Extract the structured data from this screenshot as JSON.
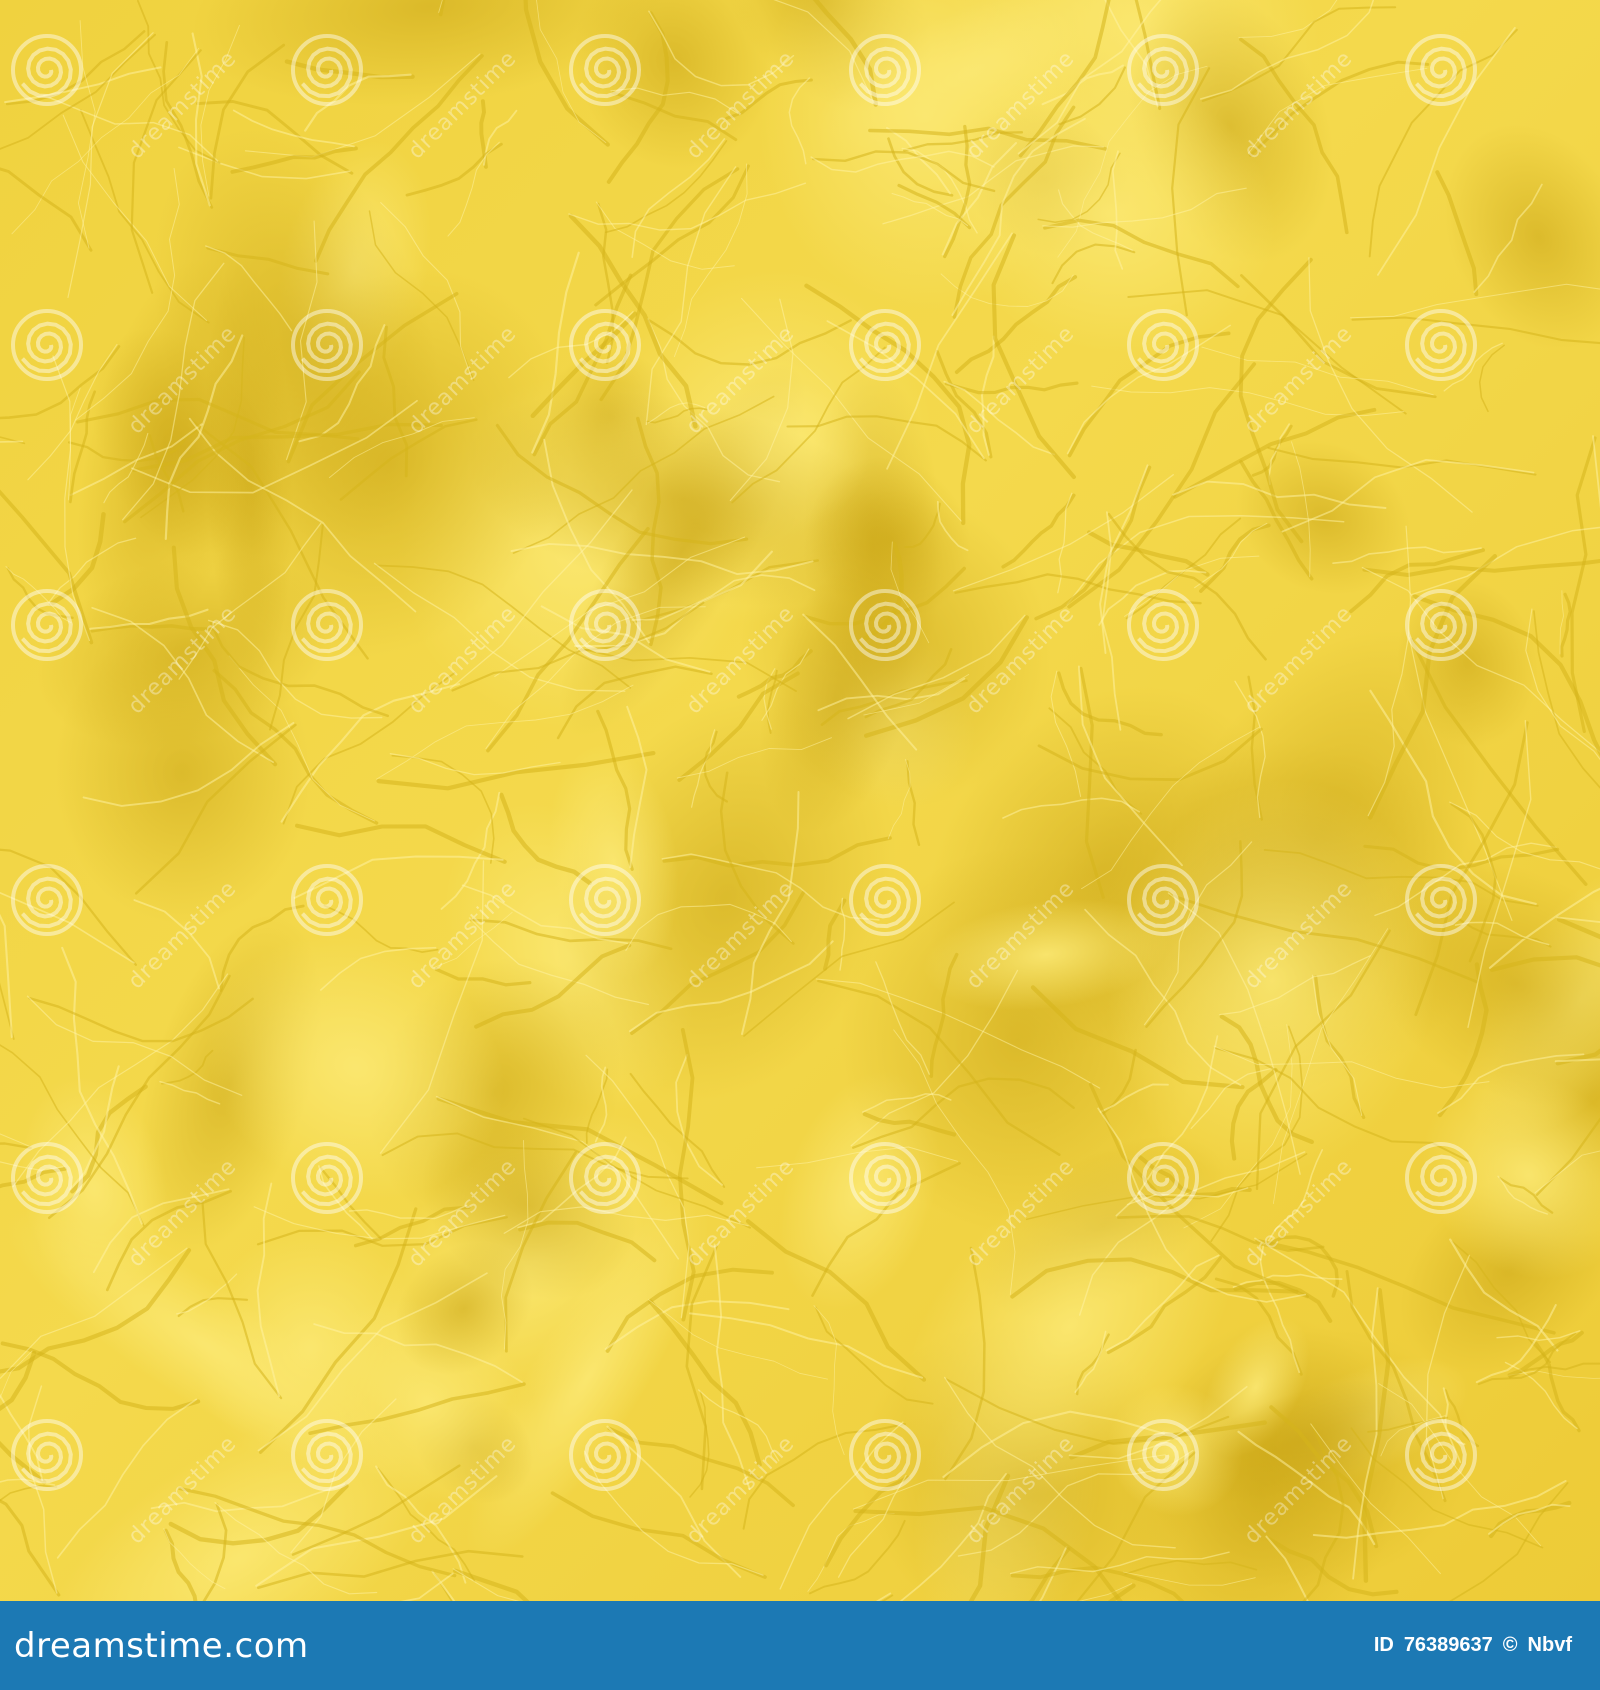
{
  "image": {
    "subject": "crumpled yellow paper texture",
    "colors": {
      "paper_base": "#f2d443",
      "paper_light": "#f8e46a",
      "paper_shadow": "#d6b41c",
      "crease_highlight": "#fff3a6",
      "footer_bar": "#1c79b4",
      "footer_text": "#ffffff"
    },
    "watermark": {
      "text": "dreamstime",
      "icon": "spiral-logo-icon"
    }
  },
  "footer": {
    "logo_text": "dreamstime.com",
    "id_label": "ID",
    "id_value": "76389637",
    "copyright_symbol": "©",
    "author": "Nbvf"
  }
}
